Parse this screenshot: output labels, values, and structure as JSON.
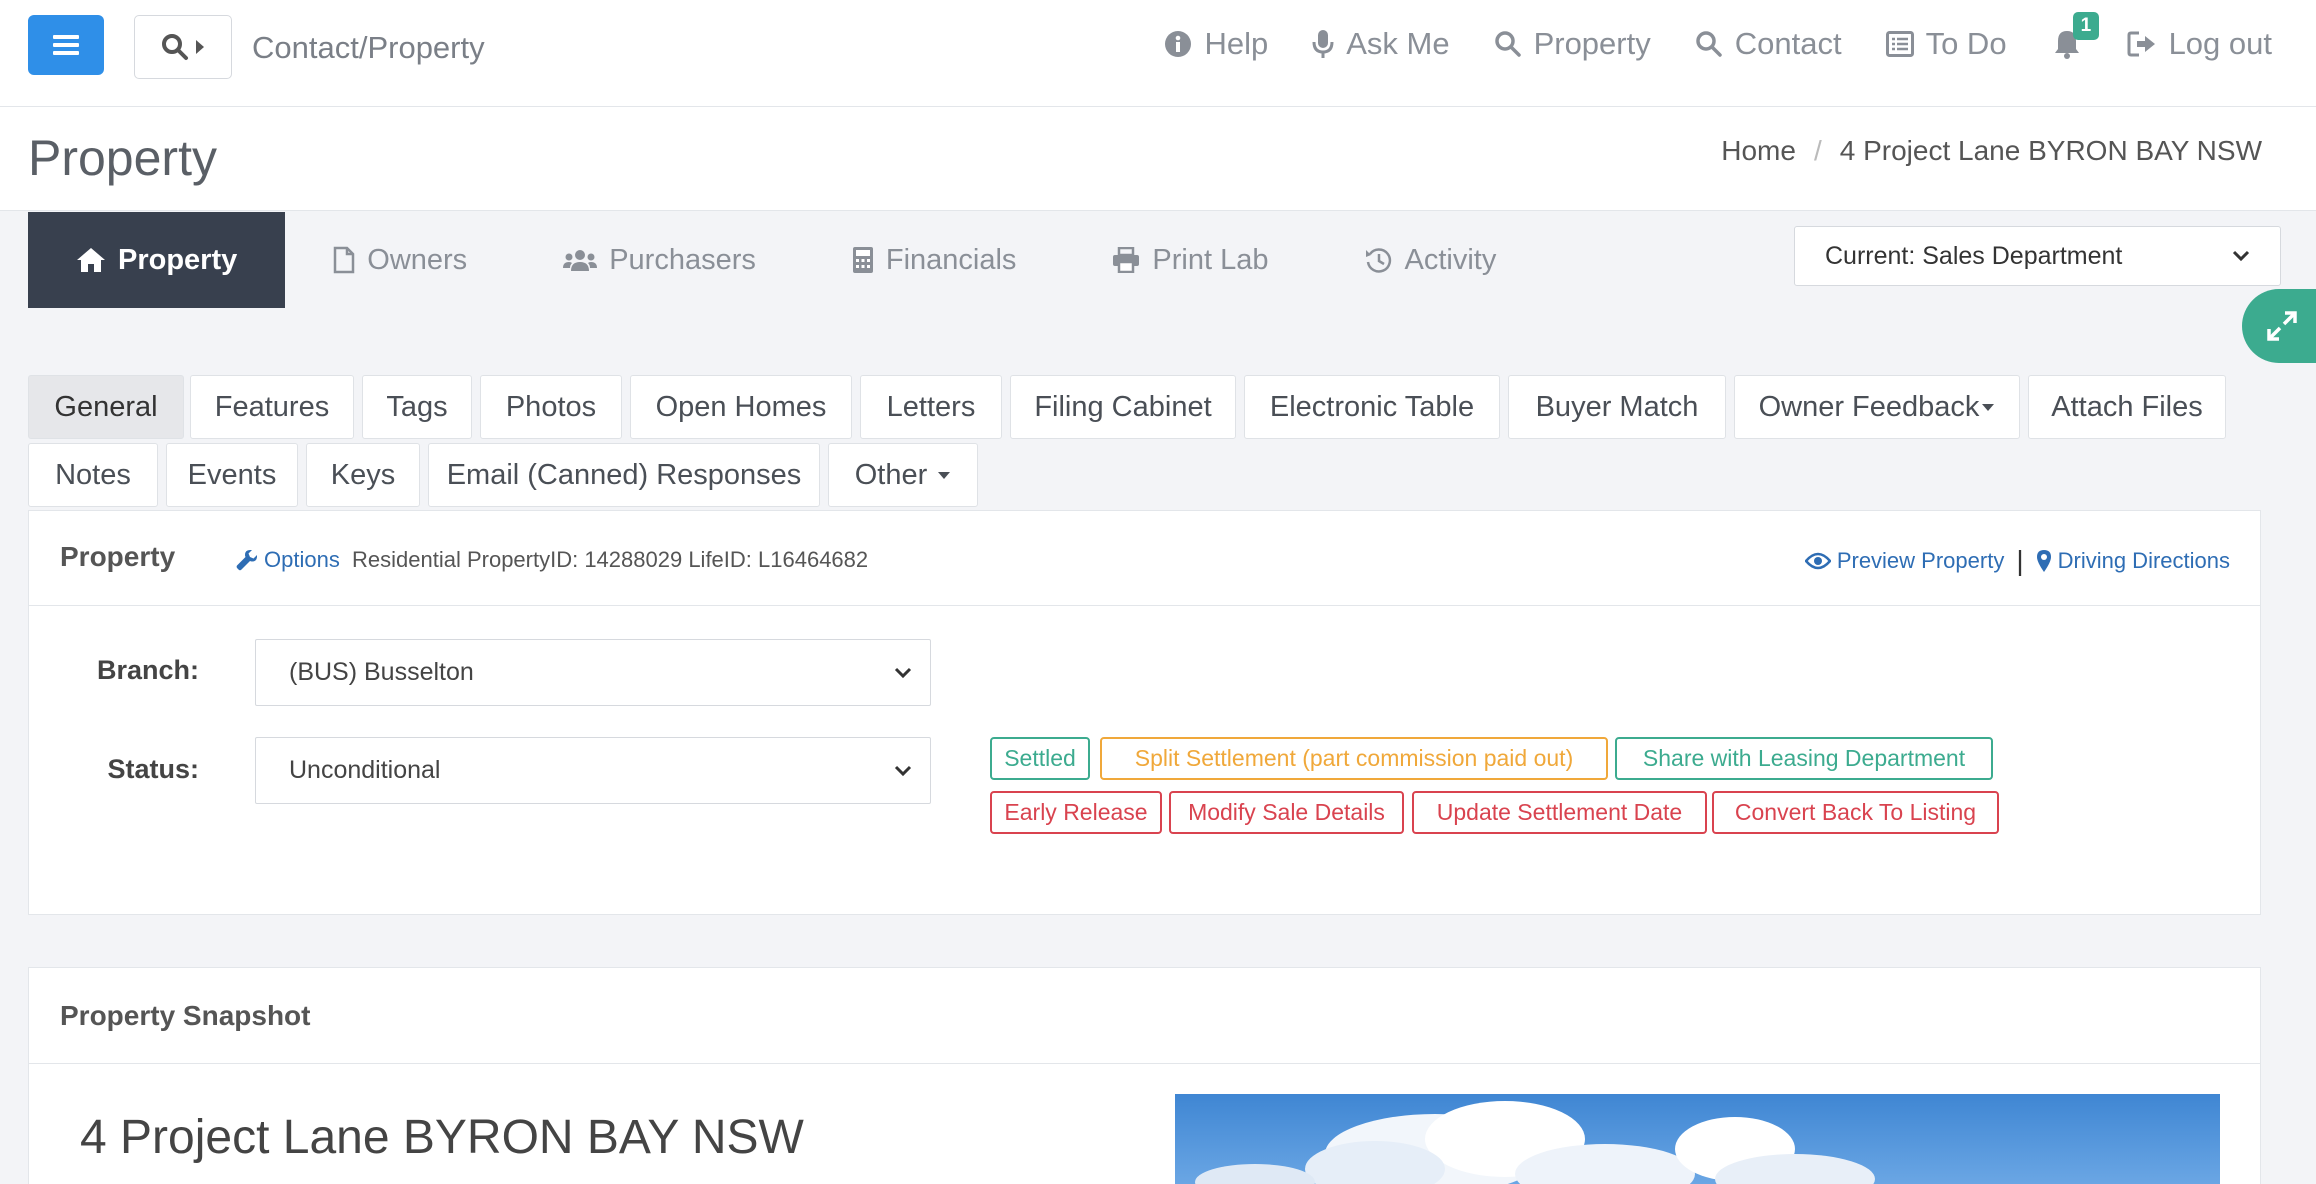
{
  "topbar": {
    "crumb": "Contact/Property",
    "nav": [
      {
        "label": "Help",
        "icon": "info-icon"
      },
      {
        "label": "Ask Me",
        "icon": "microphone-icon"
      },
      {
        "label": "Property",
        "icon": "search-icon"
      },
      {
        "label": "Contact",
        "icon": "search-icon"
      },
      {
        "label": "To Do",
        "icon": "list-icon"
      }
    ],
    "notifications_count": "1",
    "logout_label": "Log out"
  },
  "header": {
    "title": "Property",
    "breadcrumb": {
      "home": "Home",
      "separator": "/",
      "current": "4 Project Lane BYRON BAY NSW"
    }
  },
  "main_tabs": [
    {
      "label": "Property",
      "icon": "home-icon",
      "active": true
    },
    {
      "label": "Owners",
      "icon": "file-icon"
    },
    {
      "label": "Purchasers",
      "icon": "users-icon"
    },
    {
      "label": "Financials",
      "icon": "calculator-icon"
    },
    {
      "label": "Print Lab",
      "icon": "printer-icon"
    },
    {
      "label": "Activity",
      "icon": "history-icon"
    }
  ],
  "department_select": {
    "value": "Current: Sales Department"
  },
  "sub_tabs": [
    {
      "label": "General",
      "active": true
    },
    {
      "label": "Features"
    },
    {
      "label": "Tags"
    },
    {
      "label": "Photos"
    },
    {
      "label": "Open Homes"
    },
    {
      "label": "Letters"
    },
    {
      "label": "Filing Cabinet"
    },
    {
      "label": "Electronic Table"
    },
    {
      "label": "Buyer Match"
    },
    {
      "label": "Owner Feedback",
      "dropdown": true
    },
    {
      "label": "Attach Files"
    },
    {
      "label": "Notes"
    },
    {
      "label": "Events"
    },
    {
      "label": "Keys"
    },
    {
      "label": "Email (Canned) Responses"
    },
    {
      "label": "Other",
      "dropdown": true
    }
  ],
  "property_panel": {
    "title": "Property",
    "options_label": "Options",
    "meta": "Residential PropertyID: 14288029 LifeID: L16464682",
    "preview_label": "Preview Property",
    "pipe": "|",
    "directions_label": "Driving Directions",
    "branch_label": "Branch:",
    "branch_value": "(BUS) Busselton",
    "status_label": "Status:",
    "status_value": "Unconditional",
    "actions": [
      {
        "label": "Settled",
        "color": "green"
      },
      {
        "label": "Split Settlement (part commission paid out)",
        "color": "orange"
      },
      {
        "label": "Share with Leasing Department",
        "color": "green"
      },
      {
        "label": "Early Release",
        "color": "red"
      },
      {
        "label": "Modify Sale Details",
        "color": "red"
      },
      {
        "label": "Update Settlement Date",
        "color": "red"
      },
      {
        "label": "Convert Back To Listing",
        "color": "red"
      }
    ]
  },
  "snapshot": {
    "title": "Property Snapshot",
    "address": "4 Project Lane BYRON BAY NSW"
  },
  "colors": {
    "accent_blue": "#2f8fe8",
    "active_tab": "#38404e",
    "green": "#3cab8f",
    "orange": "#f0a83a",
    "red": "#d9434f",
    "link": "#2e6db4"
  }
}
